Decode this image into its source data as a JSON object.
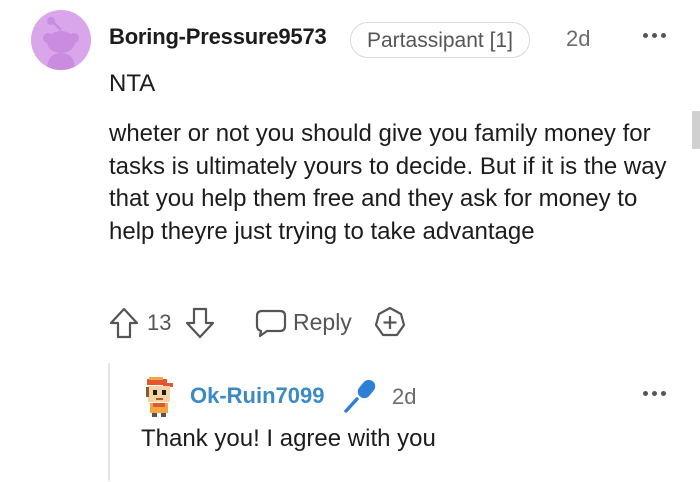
{
  "comment": {
    "author": "Boring-Pressure9573",
    "flair": "Partassipant [1]",
    "time": "2d",
    "tldr": "NTA",
    "body": "wheter or not you should give you family money for tasks is ultimately yours to decide. But if it is the way that you help them free and they ask for money to help theyre just trying to take advantage",
    "score": "13",
    "reply_label": "Reply",
    "icons": [
      "snoo-avatar",
      "upvote-icon",
      "downvote-icon",
      "reply-icon",
      "award-icon",
      "more-options-icon"
    ]
  },
  "reply": {
    "author": "Ok-Ruin7099",
    "time": "2d",
    "body": "Thank you! I agree with you",
    "icons": [
      "pixel-avatar",
      "microphone-icon",
      "more-options-icon"
    ]
  },
  "colors": {
    "avatar_bg": "#d9a6ec",
    "reply_author": "#3a8bc4",
    "mic": "#2e7fd6",
    "meta_text": "#6b6b6b"
  }
}
